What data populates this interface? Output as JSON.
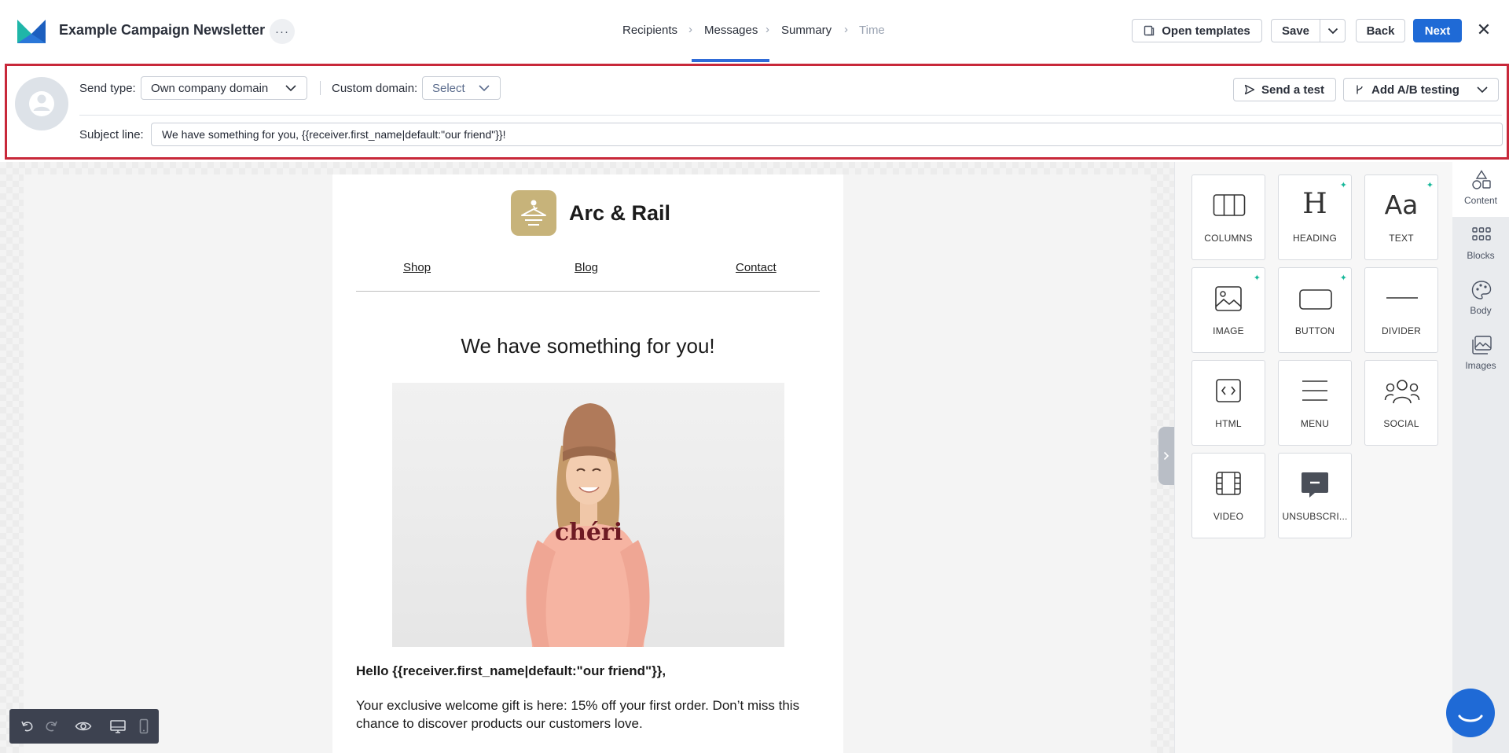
{
  "header": {
    "title": "Example Campaign Newsletter",
    "more_label": "···",
    "steps": [
      {
        "label": "Recipients",
        "state": "done"
      },
      {
        "label": "Messages",
        "state": "active"
      },
      {
        "label": "Summary",
        "state": "done"
      },
      {
        "label": "Time",
        "state": "disabled"
      }
    ],
    "step_separator": "›",
    "open_templates_label": "Open templates",
    "save_label": "Save",
    "back_label": "Back",
    "next_label": "Next",
    "close_label": "✕"
  },
  "settings": {
    "send_type_label": "Send type:",
    "send_type_value": "Own company domain",
    "custom_domain_label": "Custom domain:",
    "custom_domain_value": "Select",
    "send_test_label": "Send a test",
    "ab_testing_label": "Add A/B testing",
    "subject_label": "Subject line:",
    "subject_value": "We have something for you, {{receiver.first_name|default:\"our friend\"}}!"
  },
  "email": {
    "brand_name": "Arc & Rail",
    "nav": [
      "Shop",
      "Blog",
      "Contact"
    ],
    "heading": "We have something for you!",
    "sweater_text": "chéri",
    "greeting": "Hello {{receiver.first_name|default:\"our friend\"}},",
    "body": "Your exclusive welcome gift is here: 15% off your first order. Don’t miss this chance to discover products our customers love."
  },
  "tools": {
    "tiles": [
      {
        "label": "COLUMNS",
        "icon": "columns-icon",
        "ai": false
      },
      {
        "label": "HEADING",
        "icon": "heading-icon",
        "ai": true
      },
      {
        "label": "TEXT",
        "icon": "text-icon",
        "ai": true
      },
      {
        "label": "IMAGE",
        "icon": "image-icon",
        "ai": true
      },
      {
        "label": "BUTTON",
        "icon": "button-icon",
        "ai": true
      },
      {
        "label": "DIVIDER",
        "icon": "divider-icon",
        "ai": false
      },
      {
        "label": "HTML",
        "icon": "html-icon",
        "ai": false
      },
      {
        "label": "MENU",
        "icon": "menu-icon",
        "ai": false
      },
      {
        "label": "SOCIAL",
        "icon": "social-icon",
        "ai": false
      },
      {
        "label": "VIDEO",
        "icon": "video-icon",
        "ai": false
      },
      {
        "label": "UNSUBSCRI...",
        "icon": "unsubscribe-icon",
        "ai": false
      }
    ],
    "heading_glyph": "H",
    "text_glyph": "Aa",
    "sparkle": "✦"
  },
  "rail": {
    "items": [
      {
        "label": "Content",
        "icon": "shapes-icon"
      },
      {
        "label": "Blocks",
        "icon": "grid-icon"
      },
      {
        "label": "Body",
        "icon": "palette-icon"
      },
      {
        "label": "Images",
        "icon": "images-icon"
      }
    ],
    "active": "Content"
  },
  "colors": {
    "accent": "#1f6ad6",
    "highlight_border": "#c8283a",
    "ai_sparkle": "#18b89a",
    "brand_logo": "#c7b37a"
  }
}
